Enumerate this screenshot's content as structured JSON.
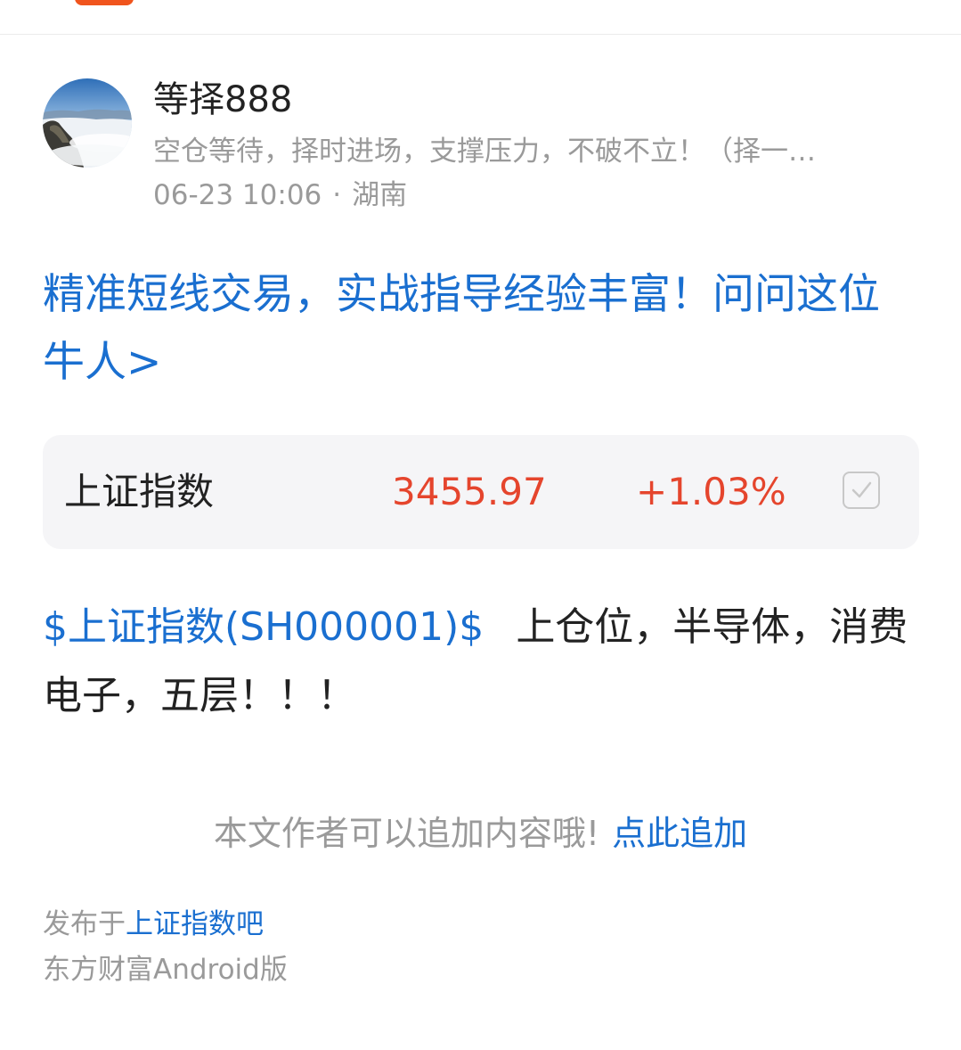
{
  "author": {
    "name": "等择888",
    "bio": "空仓等待，择时进场，支撑压力，不破不立！（择一…",
    "time": "06-23 10:06",
    "separator": "·",
    "location": "湖南"
  },
  "promo": {
    "text": "精准短线交易，实战指导经验丰富！问问这位牛人>"
  },
  "stock_card": {
    "name": "上证指数",
    "price": "3455.97",
    "change": "+1.03%",
    "price_color": "#e5452d"
  },
  "post": {
    "stock_tag": "$上证指数(SH000001)$",
    "text": "上仓位，半导体，消费电子，五层！！！"
  },
  "append": {
    "hint": "本文作者可以追加内容哦!",
    "link": "点此追加"
  },
  "footer": {
    "published_prefix": "发布于",
    "forum": "上证指数吧",
    "client": "东方财富Android版"
  },
  "colors": {
    "link": "#1a6fd0",
    "up": "#e5452d",
    "brand": "#f0541d"
  }
}
